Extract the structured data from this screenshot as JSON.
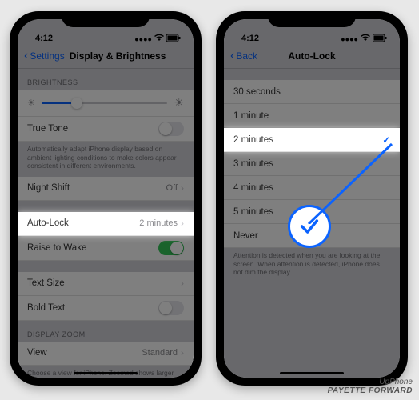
{
  "status": {
    "time": "4:12",
    "loc_icon": "location-icon",
    "signal": "▪▪▪▪",
    "wifi": "wifi-icon",
    "battery": "battery-icon"
  },
  "left": {
    "back_label": "Settings",
    "title": "Display & Brightness",
    "brightness_header": "BRIGHTNESS",
    "true_tone": {
      "label": "True Tone",
      "desc": "Automatically adapt iPhone display based on ambient lighting conditions to make colors appear consistent in different environments."
    },
    "night_shift": {
      "label": "Night Shift",
      "value": "Off"
    },
    "auto_lock": {
      "label": "Auto-Lock",
      "value": "2 minutes"
    },
    "raise": {
      "label": "Raise to Wake"
    },
    "text_size": {
      "label": "Text Size"
    },
    "bold_text": {
      "label": "Bold Text"
    },
    "zoom_header": "DISPLAY ZOOM",
    "view": {
      "label": "View",
      "value": "Standard",
      "desc": "Choose a view for iPhone. Zoomed shows larger controls. Standard shows more content."
    }
  },
  "right": {
    "back_label": "Back",
    "title": "Auto-Lock",
    "options": [
      "30 seconds",
      "1 minute",
      "2 minutes",
      "3 minutes",
      "4 minutes",
      "5 minutes",
      "Never"
    ],
    "selected_index": 2,
    "footer": "Attention is detected when you are looking at the screen. When attention is detected, iPhone does not dim the display."
  },
  "watermark": {
    "line1": "UpPhone",
    "line2": "PAYETTE FORWARD"
  }
}
